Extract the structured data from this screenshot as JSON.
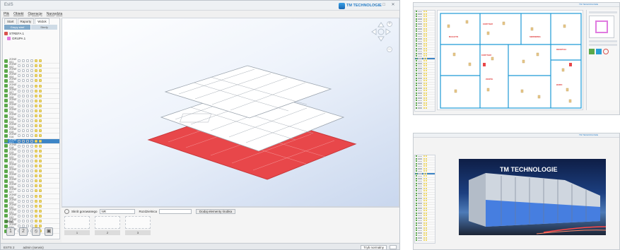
{
  "main": {
    "title": "EsIS",
    "brand": "TM TECHNOLOGIE",
    "menu": [
      "Plik",
      "Obiekt",
      "Operacje",
      "Narzędzia"
    ],
    "tabs": [
      "Start",
      "Raporty",
      "Widok"
    ],
    "sub_tabs": [
      "Grupy stref",
      "Strefy"
    ],
    "tree": {
      "root": "STREFA 1",
      "group": "GRUPA 1"
    },
    "zone_rows": [
      "ZONE 001",
      "ZONE 002",
      "ZONE 003",
      "ZONE 004",
      "ZONE 005",
      "ZONE 006",
      "ZONE 007",
      "ZONE 008",
      "ZONE 009",
      "ZONE 010",
      "ZONE 011",
      "ZONE 012",
      "ZONE 013",
      "ZONE 014",
      "ZONE 015",
      "ZONE 016",
      "ZONE 017",
      "ZONE 018",
      "ZONE 019",
      "ZONE 020",
      "ZONE 021",
      "ZONE 022",
      "ZONE 023",
      "ZONE 024",
      "ZONE 025",
      "ZONE 026",
      "ZONE 027",
      "ZONE 028",
      "ZONE 029",
      "ZONE 030",
      "ZONE 031",
      "ZONE 032",
      "ZONE 033",
      "ZONE 034",
      "ZONE 035"
    ],
    "selected_row_index": 16,
    "bottom": {
      "floor_label": "Skrót gorowanego",
      "floor_value": "NR",
      "type_label": "Rozdzielnica",
      "type_value": "",
      "action_button": "Dodaj elementy śrubka",
      "thumb_captions": [
        "1",
        "2",
        "3"
      ]
    },
    "mode_label": "Układ",
    "mode_buttons": [
      "1",
      "2",
      "⦸",
      "▣"
    ],
    "status": {
      "left": "ESTS 2",
      "center": "admin (serwis)",
      "right": "Tryb normalny"
    },
    "colors": {
      "accent": "#3d85c6",
      "floor_active": "#e8474a",
      "zone_green": "#5aa84a"
    }
  },
  "plan_window": {
    "labels": [
      "KORYTARZ",
      "MAGAZYN",
      "SERWERNIA",
      "RECEPCJA",
      "KORYTARZ",
      "ZESPÓŁ",
      "BIURO"
    ]
  },
  "photo_window": {
    "sign": "TM TECHNOLOGIE"
  }
}
